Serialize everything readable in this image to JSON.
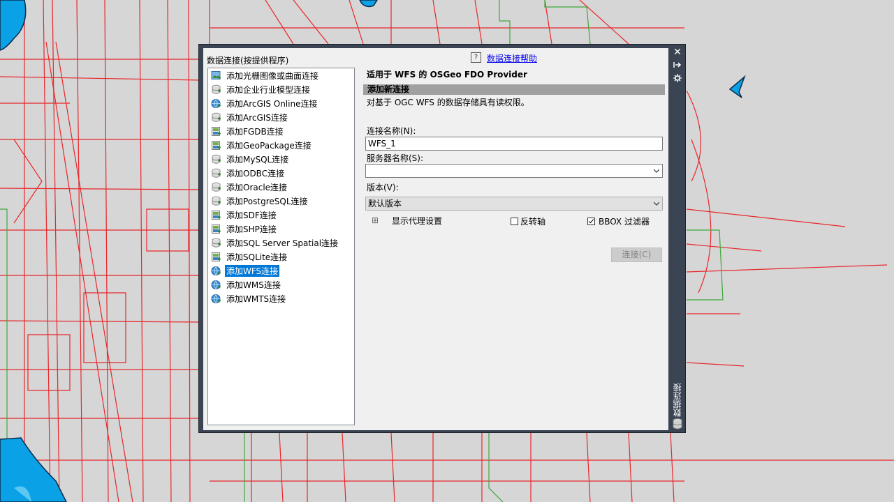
{
  "palette": {
    "vertical_title": "数据连接",
    "list_header": "数据连接(按提供程序)",
    "help_link": "数据连接帮助",
    "providers": [
      {
        "label": "添加光栅图像或曲面连接",
        "icon": "raster-icon"
      },
      {
        "label": "添加企业行业模型连接",
        "icon": "database-icon"
      },
      {
        "label": "添加ArcGIS Online连接",
        "icon": "globe-icon"
      },
      {
        "label": "添加ArcGIS连接",
        "icon": "database-icon"
      },
      {
        "label": "添加FGDB连接",
        "icon": "file-data-icon"
      },
      {
        "label": "添加GeoPackage连接",
        "icon": "file-data-icon"
      },
      {
        "label": "添加MySQL连接",
        "icon": "database-icon"
      },
      {
        "label": "添加ODBC连接",
        "icon": "database-icon"
      },
      {
        "label": "添加Oracle连接",
        "icon": "database-icon"
      },
      {
        "label": "添加PostgreSQL连接",
        "icon": "database-icon"
      },
      {
        "label": "添加SDF连接",
        "icon": "file-data-icon"
      },
      {
        "label": "添加SHP连接",
        "icon": "file-data-icon"
      },
      {
        "label": "添加SQL Server Spatial连接",
        "icon": "database-icon"
      },
      {
        "label": "添加SQLite连接",
        "icon": "file-data-icon"
      },
      {
        "label": "添加WFS连接",
        "icon": "globe-icon"
      },
      {
        "label": "添加WMS连接",
        "icon": "globe-icon"
      },
      {
        "label": "添加WMTS连接",
        "icon": "globe-icon"
      }
    ],
    "selected_index": 14,
    "provider_title": "适用于 WFS 的 OSGeo FDO Provider",
    "section_title": "添加新连接",
    "description": "对基于 OGC WFS 的数据存储具有读权限。",
    "connection_name_label": "连接名称(N):",
    "connection_name_value": "WFS_1",
    "server_name_label": "服务器名称(S):",
    "server_name_value": "",
    "version_label": "版本(V):",
    "version_value": "默认版本",
    "proxy_toggle": "⊞",
    "proxy_label": "显示代理设置",
    "invert_axis_label": "反转轴",
    "invert_axis_checked": false,
    "bbox_filter_label": "BBOX 过滤器",
    "bbox_filter_checked": true,
    "connect_button": "连接(C)"
  }
}
